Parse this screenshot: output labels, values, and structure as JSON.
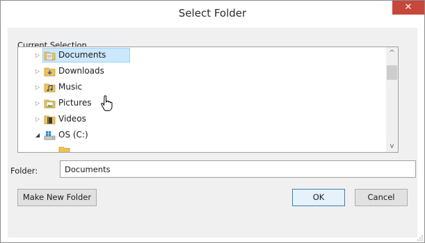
{
  "window": {
    "title": "Select Folder",
    "close_label": "✕"
  },
  "current_selection_label": "Current Selection",
  "tree": {
    "items": [
      {
        "label": "Documents",
        "expander": "▷",
        "selected": true,
        "icon": "documents-folder-icon"
      },
      {
        "label": "Downloads",
        "expander": "▷",
        "selected": false,
        "icon": "downloads-folder-icon"
      },
      {
        "label": "Music",
        "expander": "▷",
        "selected": false,
        "icon": "music-folder-icon"
      },
      {
        "label": "Pictures",
        "expander": "▷",
        "selected": false,
        "icon": "pictures-folder-icon"
      },
      {
        "label": "Videos",
        "expander": "▷",
        "selected": false,
        "icon": "videos-folder-icon"
      },
      {
        "label": "OS (C:)",
        "expander": "◢",
        "selected": false,
        "icon": "drive-icon"
      }
    ],
    "scroll_up": "^",
    "scroll_down": "v"
  },
  "folder_field": {
    "label": "Folder:",
    "value": "Documents"
  },
  "buttons": {
    "make_new_folder": "Make New Folder",
    "ok": "OK",
    "cancel": "Cancel"
  },
  "colors": {
    "close_button": "#c7473a",
    "selection_fill": "#cce8ff",
    "selection_border": "#99d1ff",
    "default_button_border": "#3c7fb1",
    "folder_yellow": "#f0c44c"
  }
}
